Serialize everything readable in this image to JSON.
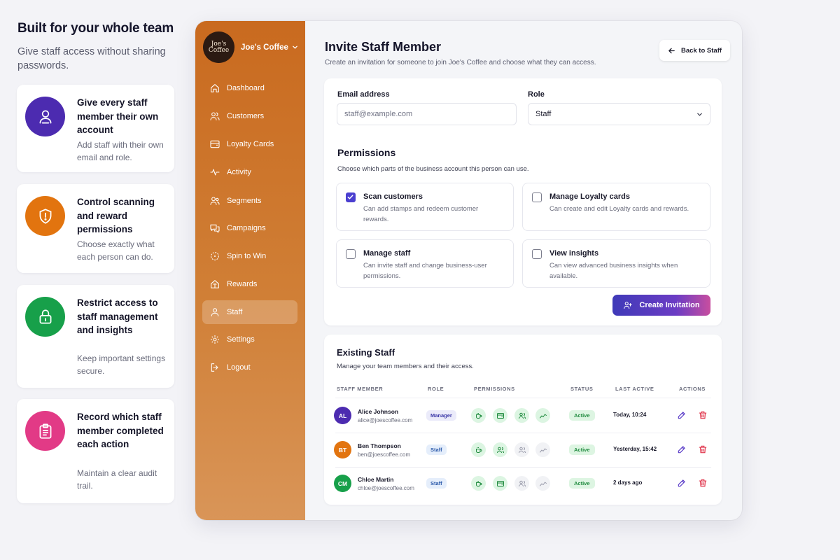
{
  "promo": {
    "title": "Built for your whole team",
    "subtitle": "Give staff access without sharing passwords.",
    "features": [
      {
        "title": "Give every staff member their own account",
        "desc": "Add staff with their own email and role.",
        "icon": "user-icon",
        "color": "#4c2bb0"
      },
      {
        "title": "Control scanning and reward permissions",
        "desc": "Choose exactly what each person can do.",
        "icon": "shield-icon",
        "color": "#e2740f"
      },
      {
        "title": "Restrict access to staff management and insights",
        "desc": "Keep important settings secure.",
        "icon": "lock-icon",
        "color": "#17a04a"
      },
      {
        "title": "Record which staff member completed each action",
        "desc": "Maintain a clear audit trail.",
        "icon": "clipboard-icon",
        "color": "#e23a86"
      }
    ]
  },
  "brand": {
    "logo_line1": "Joe's",
    "logo_line2": "Coffee",
    "name": "Joe's Coffee"
  },
  "nav": [
    {
      "label": "Dashboard",
      "icon": "home-icon"
    },
    {
      "label": "Customers",
      "icon": "users-icon"
    },
    {
      "label": "Loyalty Cards",
      "icon": "wallet-icon"
    },
    {
      "label": "Activity",
      "icon": "activity-icon"
    },
    {
      "label": "Segments",
      "icon": "segments-icon"
    },
    {
      "label": "Campaigns",
      "icon": "chat-icon"
    },
    {
      "label": "Spin to Win",
      "icon": "spin-icon"
    },
    {
      "label": "Rewards",
      "icon": "gift-icon"
    },
    {
      "label": "Staff",
      "icon": "staff-icon",
      "active": true
    },
    {
      "label": "Settings",
      "icon": "gear-icon"
    },
    {
      "label": "Logout",
      "icon": "logout-icon"
    }
  ],
  "page": {
    "title": "Invite Staff Member",
    "subtitle": "Create an invitation for someone to join Joe's Coffee and choose what they can access.",
    "back_label": "Back to Staff"
  },
  "invite": {
    "email_label": "Email address",
    "email_placeholder": "staff@example.com",
    "role_label": "Role",
    "role_value": "Staff",
    "permissions_title": "Permissions",
    "permissions_sub": "Choose which parts of the business account this person can use.",
    "permissions": [
      {
        "title": "Scan customers",
        "desc": "Can add stamps and redeem customer rewards.",
        "checked": true
      },
      {
        "title": "Manage Loyalty cards",
        "desc": "Can create and edit Loyalty cards and rewards.",
        "checked": false
      },
      {
        "title": "Manage staff",
        "desc": "Can invite staff and change business-user permissions.",
        "checked": false
      },
      {
        "title": "View insights",
        "desc": "Can view advanced business insights when available.",
        "checked": false
      }
    ],
    "create_label": "Create Invitation"
  },
  "existing": {
    "title": "Existing Staff",
    "subtitle": "Manage your team members and their access.",
    "columns": [
      "STAFF MEMBER",
      "ROLE",
      "PERMISSIONS",
      "STATUS",
      "LAST ACTIVE",
      "ACTIONS"
    ],
    "rows": [
      {
        "initials": "AL",
        "name": "Alice Johnson",
        "email": "alice@joescoffee.com",
        "role": "Manager",
        "avatar_color": "#4c2bb0",
        "perms": [
          true,
          true,
          true,
          true
        ],
        "status": "Active",
        "last_active": "Today, 10:24"
      },
      {
        "initials": "BT",
        "name": "Ben Thompson",
        "email": "ben@joescoffee.com",
        "role": "Staff",
        "avatar_color": "#e2740f",
        "perms": [
          true,
          true,
          false,
          false
        ],
        "status": "Active",
        "last_active": "Yesterday, 15:42"
      },
      {
        "initials": "CM",
        "name": "Chloe Martin",
        "email": "chloe@joescoffee.com",
        "role": "Staff",
        "avatar_color": "#17a04a",
        "perms": [
          true,
          true,
          false,
          false
        ],
        "status": "Active",
        "last_active": "2 days ago"
      }
    ]
  },
  "colors": {
    "accent": "#4b3fd0",
    "sidebar_top": "#c96a1f",
    "sidebar_bottom": "#d99558",
    "active_green": "#1f8a3e",
    "delete_red": "#e0344b",
    "edit_purple": "#5a3cc8"
  }
}
